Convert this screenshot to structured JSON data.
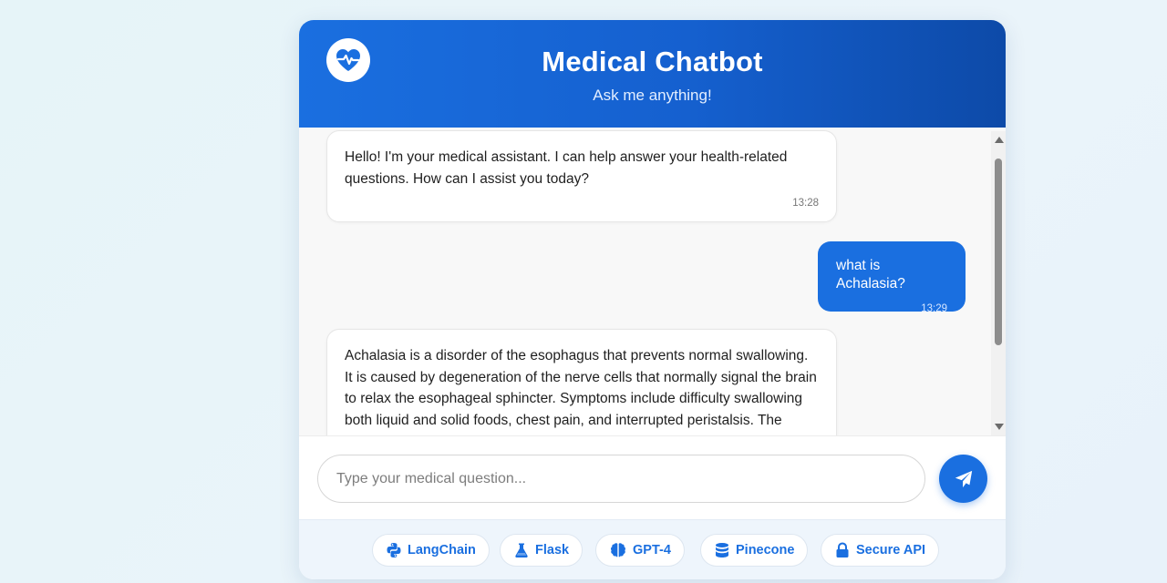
{
  "header": {
    "title": "Medical Chatbot",
    "subtitle": "Ask me anything!",
    "logo_icon": "heart-pulse-icon"
  },
  "messages": [
    {
      "role": "bot",
      "text": "Hello! I'm your medical assistant. I can help answer your health-related questions. How can I assist you today?",
      "time": "13:28"
    },
    {
      "role": "user",
      "text": "what is Achalasia?",
      "time": "13:29"
    },
    {
      "role": "bot",
      "text": "Achalasia is a disorder of the esophagus that prevents normal swallowing. It is caused by degeneration of the nerve cells that normally signal the brain to relax the esophageal sphincter. Symptoms include difficulty swallowing both liquid and solid foods, chest pain, and interrupted peristalsis. The"
    }
  ],
  "input": {
    "placeholder": "Type your medical question...",
    "value": ""
  },
  "send_icon": "paper-plane-icon",
  "tech_badges": [
    {
      "label": "LangChain",
      "icon": "python-icon"
    },
    {
      "label": "Flask",
      "icon": "flask-icon"
    },
    {
      "label": "GPT-4",
      "icon": "brain-icon"
    },
    {
      "label": "Pinecone",
      "icon": "database-icon"
    },
    {
      "label": "Secure API",
      "icon": "lock-icon"
    }
  ],
  "colors": {
    "primary": "#1a6fe0",
    "header_dark": "#0d4aa8",
    "chat_bg": "#f8f8f8",
    "footer_bg": "#eef5fc"
  }
}
